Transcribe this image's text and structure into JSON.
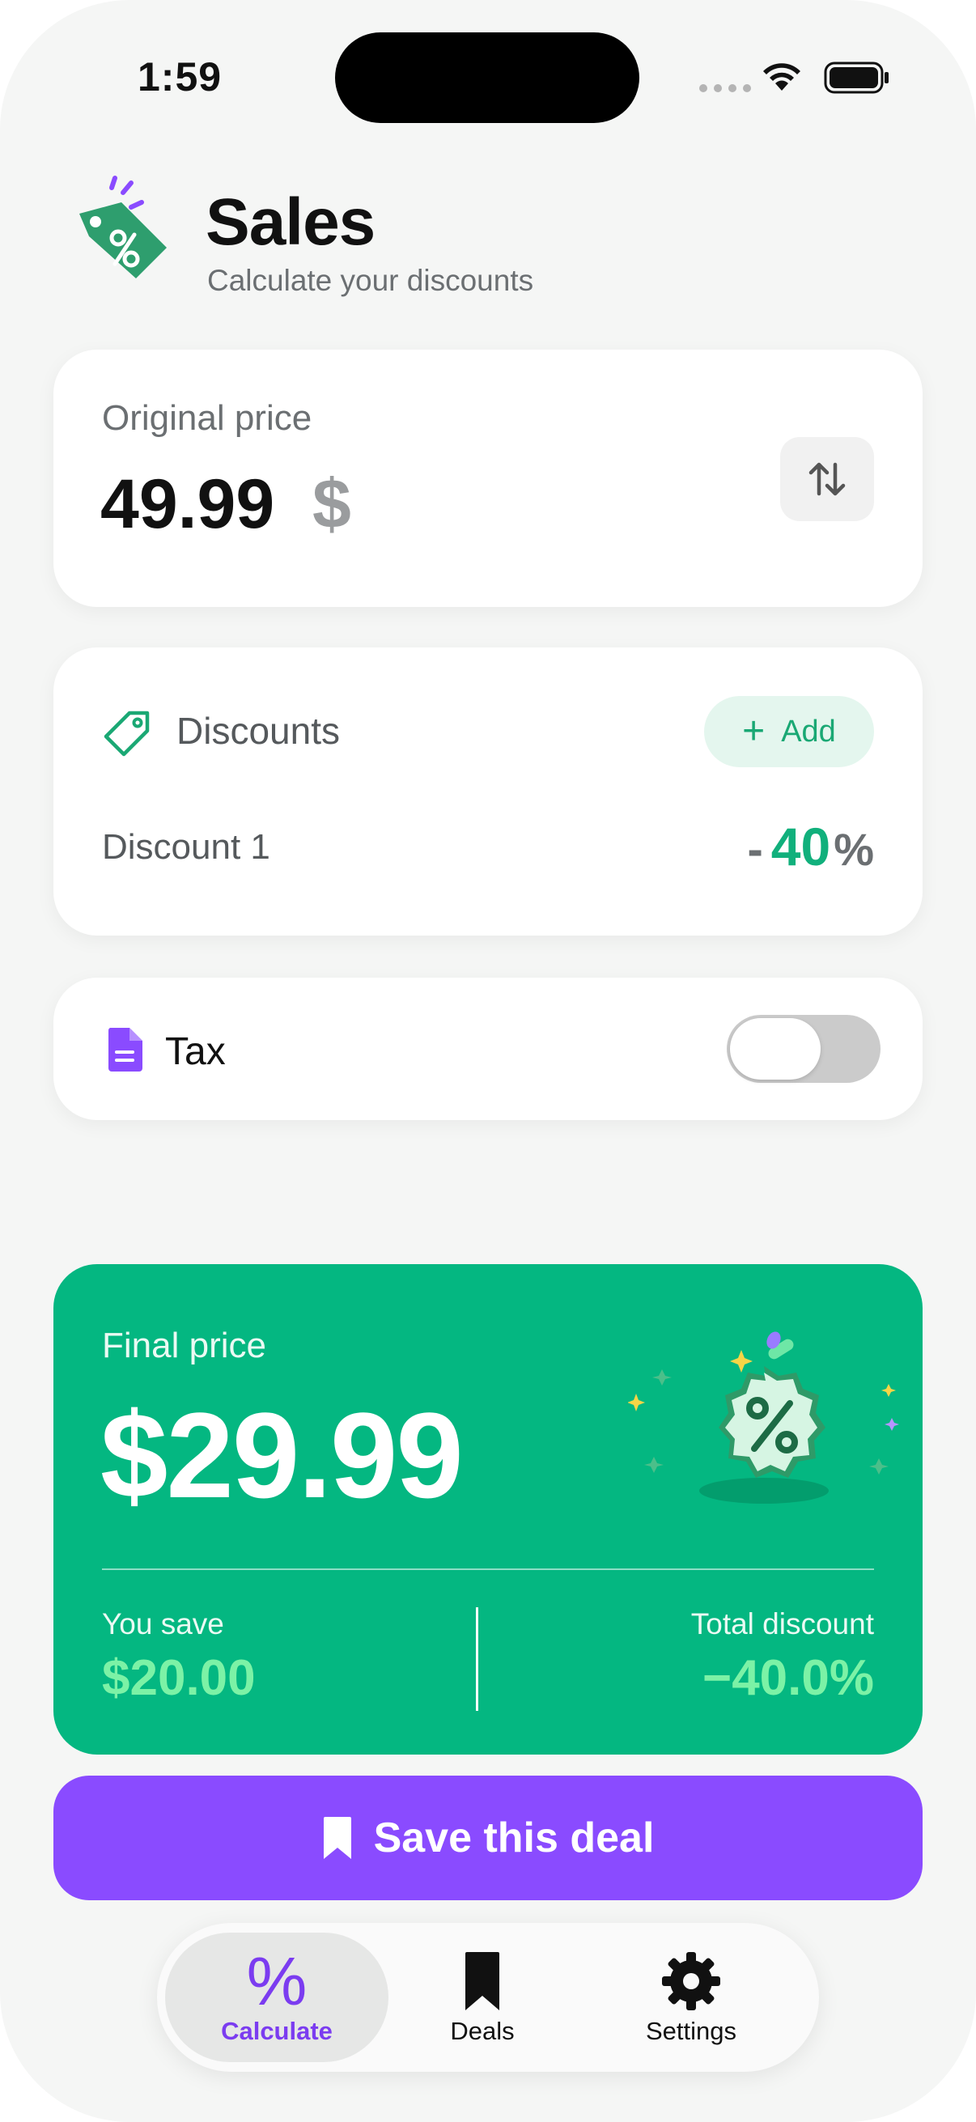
{
  "status_bar": {
    "time": "1:59"
  },
  "header": {
    "title": "Sales",
    "subtitle": "Calculate your discounts"
  },
  "original_price": {
    "label": "Original price",
    "value": "49.99",
    "currency": "$"
  },
  "discounts": {
    "title": "Discounts",
    "add_label": "Add",
    "items": [
      {
        "name": "Discount 1",
        "sign": "-",
        "value": "40",
        "unit": "%"
      }
    ]
  },
  "tax": {
    "label": "Tax",
    "enabled": false
  },
  "final": {
    "label": "Final price",
    "value": "$29.99",
    "you_save_label": "You save",
    "you_save_value": "$20.00",
    "total_discount_label": "Total discount",
    "total_discount_value": "−40.0%"
  },
  "save_button": {
    "label": "Save this deal"
  },
  "tabbar": {
    "tabs": [
      {
        "label": "Calculate",
        "icon": "percent-icon",
        "active": true
      },
      {
        "label": "Deals",
        "icon": "bookmark-icon",
        "active": false
      },
      {
        "label": "Settings",
        "icon": "gear-icon",
        "active": false
      }
    ]
  },
  "colors": {
    "accent_green": "#04b781",
    "accent_purple": "#8a4bff",
    "highlight_green": "#7cf2a6"
  }
}
